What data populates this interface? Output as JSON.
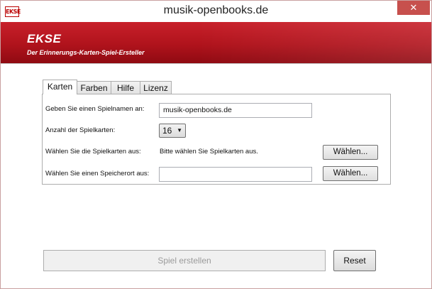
{
  "window": {
    "title": "musik-openbooks.de",
    "icon_text": "EKSE",
    "close_glyph": "✕"
  },
  "header": {
    "brand": "EKSE",
    "tagline": "Der Erinnerungs-Karten-Spiel-Ersteller",
    "accent": "#b0131c"
  },
  "tabs": [
    {
      "label": "Karten",
      "active": true
    },
    {
      "label": "Farben",
      "active": false
    },
    {
      "label": "Hilfe",
      "active": false
    },
    {
      "label": "Lizenz",
      "active": false
    }
  ],
  "form": {
    "name_label": "Geben Sie einen Spielnamen an:",
    "name_value": "musik-openbooks.de",
    "count_label": "Anzahl der Spielkarten:",
    "count_value": "16",
    "cards_label": "Wählen Sie die Spielkarten aus:",
    "cards_status": "Bitte wählen Sie Spielkarten aus.",
    "cards_button": "Wählen...",
    "location_label": "Wählen Sie einen Speicherort aus:",
    "location_value": "",
    "location_button": "Wählen..."
  },
  "footer": {
    "create_label": "Spiel erstellen",
    "create_enabled": false,
    "reset_label": "Reset"
  }
}
